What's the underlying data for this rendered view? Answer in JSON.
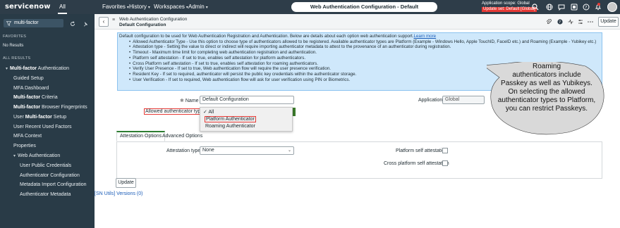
{
  "topbar": {
    "logo": "servicenow",
    "all_label": "All",
    "nav": [
      "Favorites",
      "History",
      "Workspaces",
      "Admin"
    ],
    "title": "Web Authentication Configuration - Default Configuration",
    "scope_line1": "Application scope: Global",
    "scope_line2": "Update set: Default [Global]"
  },
  "sidebar": {
    "filter_value": "multi-factor",
    "favorites_heading": "FAVORITES",
    "no_results": "No Results",
    "all_results_heading": "ALL RESULTS",
    "items": [
      {
        "bold": "Multi-factor",
        "rest": " Authentication"
      },
      {
        "bold": "",
        "rest": "Guided Setup"
      },
      {
        "bold": "",
        "rest": "MFA Dashboard"
      },
      {
        "bold": "Multi-factor",
        "rest": " Criteria"
      },
      {
        "bold": "Multi-factor",
        "rest": " Browser Fingerprints"
      },
      {
        "bold": "",
        "rest": "User ",
        "bold2": "Multi-factor",
        "rest2": " Setup"
      },
      {
        "bold": "",
        "rest": "User Recent Used Factors"
      },
      {
        "bold": "",
        "rest": "MFA Context"
      },
      {
        "bold": "",
        "rest": "Properties"
      },
      {
        "bold": "",
        "rest": "Web Authentication"
      },
      {
        "bold": "",
        "rest": "User Public Credentials"
      },
      {
        "bold": "",
        "rest": "Authenticator Configuration"
      },
      {
        "bold": "",
        "rest": "Metadata Import Configuration"
      },
      {
        "bold": "",
        "rest": "Authenticator Metadata"
      }
    ]
  },
  "form": {
    "header_title": "Web Authentication Configuration",
    "header_sub": "Default Configuration",
    "update_label": "Update",
    "info_intro": "Default configuration to be used for Web Authentication Registration and Authentication. Below are details about each option web authentication support.",
    "info_link": "Learn more",
    "info_items": [
      "Allowed Authenticator Type - Use this option to choose type of authenticators allowed to be registered. Available authenticator types are Platform (Example - Windows Hello, Apple TouchID, FaceID etc.) and Roaming (Example - Yubikey etc.)",
      "Attestation type - Setting the value to direct or indirect will require importing authenticator metadata to attest to the provenance of an authenticator during registration.",
      "Timeout - Maximum time limit for completing web authentication registration and authentication.",
      "Platform self attestation - If set to true, enables self attestation for platform authenticators.",
      "Cross Platform self attestation - If set to true, enables self attestation for roaming authenticators.",
      "Verify User Presence - If set to true, Web authentication flow will require the user presence verification.",
      "Resident Key - If set to required, authenticator will persist the public key credentials within the authenticator storage.",
      "User Verification - If set to required, Web authentication flow will ask for user verification using PIN or Biometrics."
    ],
    "name_label": "Name",
    "name_value": "Default Configuration",
    "application_label": "Application",
    "application_value": "Global",
    "allowed_label": "Allowed authenticator type",
    "dropdown_options": [
      "All",
      "Platform Authenticator",
      "Roaming Authenticator"
    ],
    "tabs": [
      "Attestation Options",
      "Advanced Options"
    ],
    "attestation_label": "Attestation type",
    "attestation_value": "None",
    "platform_self_label": "Platform self attestation",
    "cross_self_label": "Cross platform self attestation",
    "bottom_update": "Update",
    "bottom_link": "[SN Utils] Versions (0)"
  },
  "callout": {
    "lines": [
      "Roaming",
      "authenticators include",
      "Passkey as well as Yubikeys.",
      "On selecting the allowed",
      "authenticator types to Platform,",
      "you can restrict Passkeys."
    ]
  },
  "colors": {
    "topbar": "#2e3d49",
    "sidebar": "#293b47",
    "info_bg": "#cfe8fb",
    "highlight": "#e53935",
    "callout_fill": "#d9d9d9"
  }
}
